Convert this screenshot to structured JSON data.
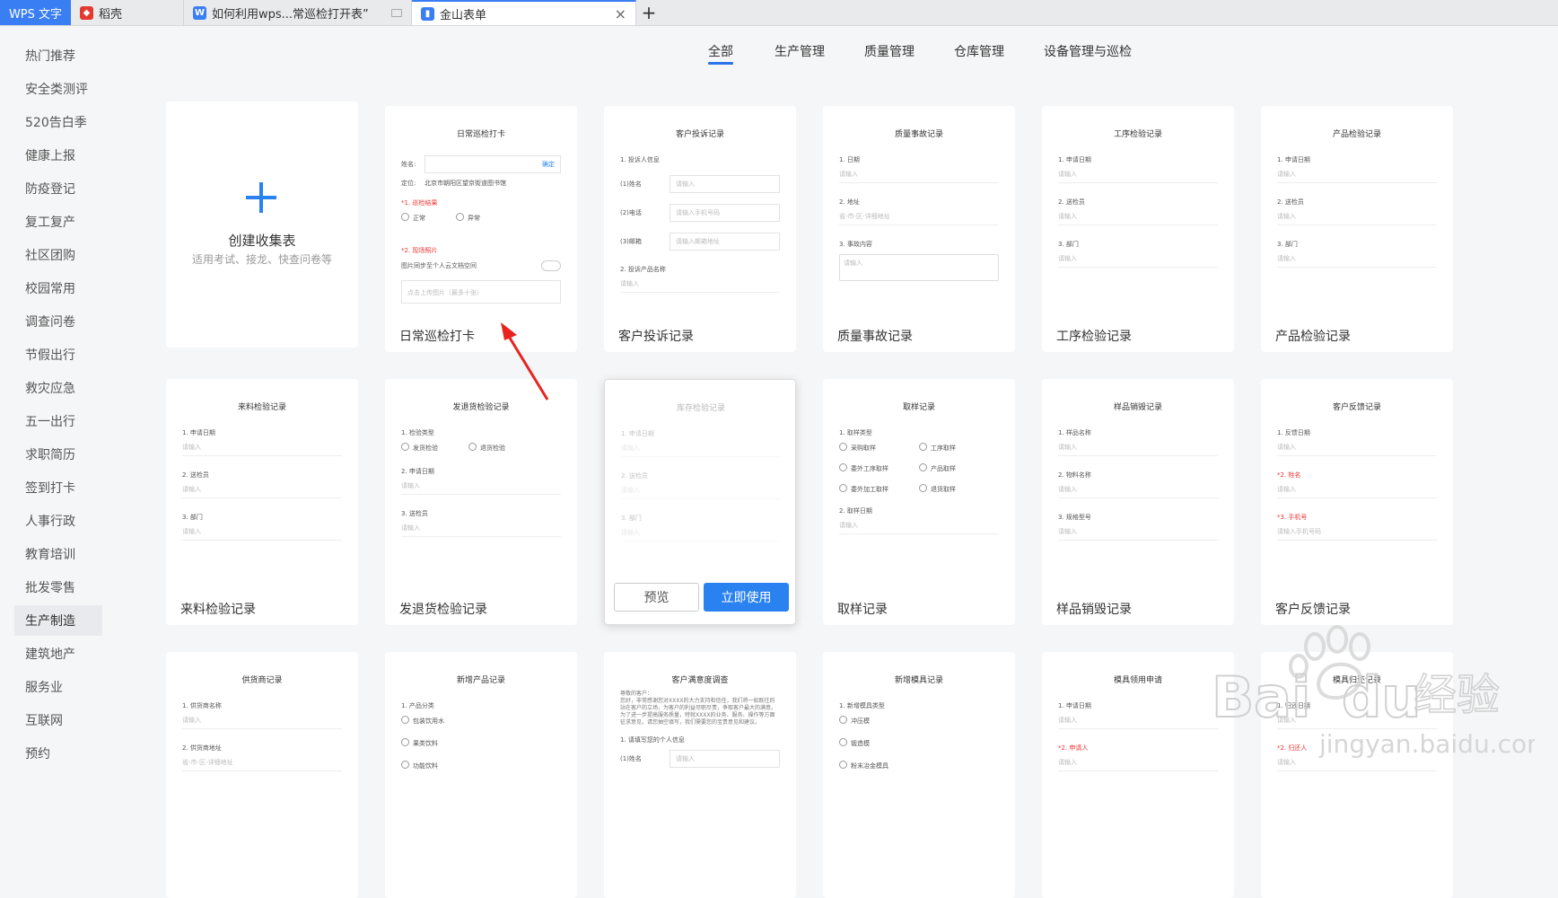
{
  "tabbar": {
    "app_label": "WPS 文字",
    "tabs": [
      {
        "label": "稻壳"
      },
      {
        "label": "如何利用wps...常巡检打开表”"
      },
      {
        "label": "金山表单"
      }
    ],
    "new_tab": "+",
    "close": "×"
  },
  "sidebar": {
    "items": [
      "热门推荐",
      "安全类测评",
      "520告白季",
      "健康上报",
      "防疫登记",
      "复工复产",
      "社区团购",
      "校园常用",
      "调查问卷",
      "节假出行",
      "救灾应急",
      "五一出行",
      "求职简历",
      "签到打卡",
      "人事行政",
      "教育培训",
      "批发零售",
      "生产制造",
      "建筑地产",
      "服务业",
      "互联网",
      "预约"
    ],
    "active": "生产制造"
  },
  "categories": {
    "tabs": [
      "全部",
      "生产管理",
      "质量管理",
      "仓库管理",
      "设备管理与巡检"
    ],
    "active": "全部"
  },
  "create_card": {
    "title": "创建收集表",
    "subtitle": "适用考试、接龙、快查问卷等"
  },
  "actions": {
    "preview": "预览",
    "use": "立即使用"
  },
  "cards": {
    "c1": {
      "title": "日常巡检打卡",
      "pv_title": "日常巡检打卡",
      "name_label": "姓名:",
      "confirm": "确定",
      "location_label": "定位:",
      "location": "北京市朝阳区望京街道图书馆",
      "q1": "*1. 巡检结果",
      "opt1": "正常",
      "opt2": "异常",
      "q2": "*2. 现场照片",
      "toggle_label": "图片同步至个人云文档空间",
      "upload": "点击上传图片（最多十张）"
    },
    "c2": {
      "title": "客户投诉记录",
      "pv_title": "客户投诉记录",
      "q1": "1. 投诉人信息",
      "r1": "(1)姓名",
      "r2": "(2)电话",
      "r3": "(3)邮箱",
      "p1": "请输入",
      "p2": "请输入手机号码",
      "p3": "请输入邮箱地址",
      "q2": "2. 投诉产品名称",
      "p4": "请输入"
    },
    "c3": {
      "title": "质量事故记录",
      "pv_title": "质量事故记录",
      "q1": "1. 日期",
      "p1": "请输入",
      "q2": "2. 地址",
      "p2": "省-市-区-详细地址",
      "q3": "3. 事故内容",
      "p3": "请输入"
    },
    "c4": {
      "title": "工序检验记录",
      "pv_title": "工序检验记录",
      "q1": "1. 申请日期",
      "q2": "2. 送检员",
      "q3": "3. 部门",
      "p": "请输入"
    },
    "c5": {
      "title": "产品检验记录",
      "pv_title": "产品检验记录",
      "q1": "1. 申请日期",
      "q2": "2. 送检员",
      "q3": "3. 部门",
      "p": "请输入"
    },
    "c6": {
      "title": "来料检验记录",
      "pv_title": "来料检验记录",
      "q1": "1. 申请日期",
      "q2": "2. 送检员",
      "q3": "3. 部门",
      "p": "请输入"
    },
    "c7": {
      "title": "发退货检验记录",
      "pv_title": "发退货检验记录",
      "q1": "1. 检验类型",
      "opt1": "发货检验",
      "opt2": "退货检验",
      "q2": "2. 申请日期",
      "q3": "3. 送检员",
      "p": "请输入"
    },
    "c8": {
      "title": "库存检验记录",
      "pv_title": "库存检验记录",
      "q1": "1. 申请日期",
      "q2": "2. 送检员",
      "q3": "3. 部门",
      "p": "请输入"
    },
    "c9": {
      "title": "取样记录",
      "pv_title": "取样记录",
      "q1": "1. 取样类型",
      "o1": "采购取样",
      "o2": "工序取样",
      "o3": "委外工序取样",
      "o4": "产品取样",
      "o5": "委外加工取样",
      "o6": "退货取样",
      "q2": "2. 取样日期",
      "p": "请输入"
    },
    "c10": {
      "title": "样品销毁记录",
      "pv_title": "样品销毁记录",
      "q1": "1. 样品名称",
      "q2": "2. 物料名称",
      "q3": "3. 规格型号",
      "p": "请输入"
    },
    "c11": {
      "title": "客户反馈记录",
      "pv_title": "客户反馈记录",
      "q1": "1. 反馈日期",
      "q2": "*2. 姓名",
      "q3": "*3. 手机号",
      "p": "请输入",
      "p3": "请输入手机号码"
    },
    "c12": {
      "pv_title": "供货商记录",
      "q1": "1. 供货商名称",
      "q2": "2. 供货商地址",
      "p1": "请输入",
      "p2": "省-市-区-详细地址"
    },
    "c13": {
      "pv_title": "新增产品记录",
      "q1": "1. 产品分类",
      "o1": "包装饮用水",
      "o2": "果类饮料",
      "o3": "功能饮料"
    },
    "c14": {
      "pv_title": "客户满意度调查",
      "para1": "尊敬的客户：",
      "para2": "您好，非常感谢您对XXXX的大力支持和信任，我们将一如既往的站在客户的立场，为客户的利益尽职尽责，争取客户最大的满意。",
      "para3": "为了进一步提高服务质量，特就XXXX的业务、服务、操作等方面征求意见，请您抽空填写，我们需要您的宝贵意见和建议。",
      "q1": "1. 请填写您的个人信息",
      "r1": "(1)姓名",
      "p1": "请输入"
    },
    "c15": {
      "pv_title": "新增模具记录",
      "q1": "1. 新增模具类型",
      "o1": "冲压模",
      "o2": "锻造模",
      "o3": "粉末冶金模具"
    },
    "c16": {
      "pv_title": "模具领用申请",
      "q1": "1. 申请日期",
      "q2": "*2. 申请人",
      "p": "请输入"
    },
    "c17": {
      "pv_title": "模具归还记录",
      "q1": "1. 归还日期",
      "q2": "*2. 归还人",
      "p": "请输入"
    }
  },
  "watermark": {
    "brand": "Bai",
    "brand2": "du",
    "cn": "经验",
    "url": "jingyan.baidu.com"
  }
}
